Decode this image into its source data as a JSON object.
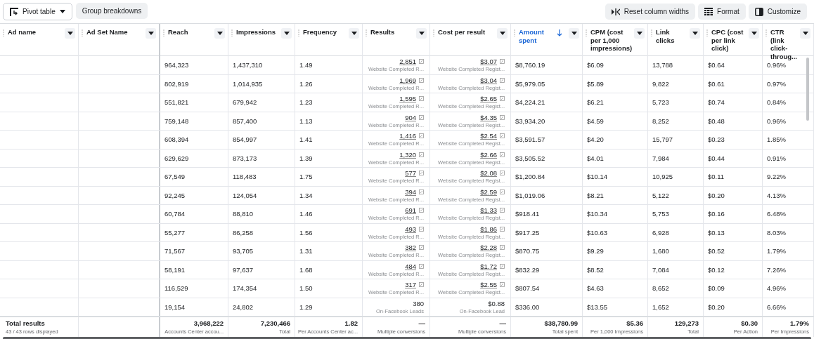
{
  "toolbar": {
    "left": [
      {
        "label": "Pivot table",
        "kind": "pivot"
      },
      {
        "label": "Group breakdowns",
        "kind": "plain"
      }
    ],
    "right": [
      {
        "label": "Reset column widths",
        "kind": "reset"
      },
      {
        "label": "Format",
        "kind": "format"
      },
      {
        "label": "Customize",
        "kind": "customize"
      }
    ]
  },
  "columns": [
    {
      "label": "Ad name",
      "sorted": false
    },
    {
      "label": "Ad Set Name",
      "sorted": false
    },
    {
      "label": "Reach",
      "sorted": false
    },
    {
      "label": "Impressions",
      "sorted": false
    },
    {
      "label": "Frequency",
      "sorted": false
    },
    {
      "label": "Results",
      "sorted": false
    },
    {
      "label": "Cost per result",
      "sorted": false
    },
    {
      "label": "Amount spent",
      "sorted": true
    },
    {
      "label": "CPM (cost per 1,000 impressions)",
      "sorted": false
    },
    {
      "label": "Link clicks",
      "sorted": false
    },
    {
      "label": "CPC (cost per link click)",
      "sorted": false
    },
    {
      "label": "CTR (link click-throug...",
      "sorted": false
    }
  ],
  "rows": [
    {
      "reach": "964,323",
      "impressions": "1,437,310",
      "frequency": "1.49",
      "results": {
        "value": "2,851",
        "note": "Website Completed R...",
        "linked": true
      },
      "cost": {
        "value": "$3.07",
        "note": "Website Completed Regist...",
        "linked": true
      },
      "amount": "$8,760.19",
      "cpm": "$6.09",
      "clicks": "13,788",
      "cpc": "$0.64",
      "ctr": "0.96%"
    },
    {
      "reach": "802,919",
      "impressions": "1,014,935",
      "frequency": "1.26",
      "results": {
        "value": "1,969",
        "note": "Website Completed R...",
        "linked": true
      },
      "cost": {
        "value": "$3.04",
        "note": "Website Completed Regist...",
        "linked": true
      },
      "amount": "$5,979.05",
      "cpm": "$5.89",
      "clicks": "9,822",
      "cpc": "$0.61",
      "ctr": "0.97%"
    },
    {
      "reach": "551,821",
      "impressions": "679,942",
      "frequency": "1.23",
      "results": {
        "value": "1,595",
        "note": "Website Completed R...",
        "linked": true
      },
      "cost": {
        "value": "$2.65",
        "note": "Website Completed Regist...",
        "linked": true
      },
      "amount": "$4,224.21",
      "cpm": "$6.21",
      "clicks": "5,723",
      "cpc": "$0.74",
      "ctr": "0.84%"
    },
    {
      "reach": "759,148",
      "impressions": "857,400",
      "frequency": "1.13",
      "results": {
        "value": "904",
        "note": "Website Completed R...",
        "linked": true
      },
      "cost": {
        "value": "$4.35",
        "note": "Website Completed Regist...",
        "linked": true
      },
      "amount": "$3,934.20",
      "cpm": "$4.59",
      "clicks": "8,252",
      "cpc": "$0.48",
      "ctr": "0.96%"
    },
    {
      "reach": "608,394",
      "impressions": "854,997",
      "frequency": "1.41",
      "results": {
        "value": "1,416",
        "note": "Website Completed R...",
        "linked": true
      },
      "cost": {
        "value": "$2.54",
        "note": "Website Completed Regist...",
        "linked": true
      },
      "amount": "$3,591.57",
      "cpm": "$4.20",
      "clicks": "15,797",
      "cpc": "$0.23",
      "ctr": "1.85%"
    },
    {
      "reach": "629,629",
      "impressions": "873,173",
      "frequency": "1.39",
      "results": {
        "value": "1,320",
        "note": "Website Completed R...",
        "linked": true
      },
      "cost": {
        "value": "$2.66",
        "note": "Website Completed Regist...",
        "linked": true
      },
      "amount": "$3,505.52",
      "cpm": "$4.01",
      "clicks": "7,984",
      "cpc": "$0.44",
      "ctr": "0.91%"
    },
    {
      "reach": "67,549",
      "impressions": "118,483",
      "frequency": "1.75",
      "results": {
        "value": "577",
        "note": "Website Completed R...",
        "linked": true
      },
      "cost": {
        "value": "$2.08",
        "note": "Website Completed Regist...",
        "linked": true
      },
      "amount": "$1,200.84",
      "cpm": "$10.14",
      "clicks": "10,925",
      "cpc": "$0.11",
      "ctr": "9.22%"
    },
    {
      "reach": "92,245",
      "impressions": "124,054",
      "frequency": "1.34",
      "results": {
        "value": "394",
        "note": "Website Completed R...",
        "linked": true
      },
      "cost": {
        "value": "$2.59",
        "note": "Website Completed Regist...",
        "linked": true
      },
      "amount": "$1,019.06",
      "cpm": "$8.21",
      "clicks": "5,122",
      "cpc": "$0.20",
      "ctr": "4.13%"
    },
    {
      "reach": "60,784",
      "impressions": "88,810",
      "frequency": "1.46",
      "results": {
        "value": "691",
        "note": "Website Completed R...",
        "linked": true
      },
      "cost": {
        "value": "$1.33",
        "note": "Website Completed Regist...",
        "linked": true
      },
      "amount": "$918.41",
      "cpm": "$10.34",
      "clicks": "5,753",
      "cpc": "$0.16",
      "ctr": "6.48%"
    },
    {
      "reach": "55,277",
      "impressions": "86,258",
      "frequency": "1.56",
      "results": {
        "value": "493",
        "note": "Website Completed R...",
        "linked": true
      },
      "cost": {
        "value": "$1.86",
        "note": "Website Completed Regist...",
        "linked": true
      },
      "amount": "$917.25",
      "cpm": "$10.63",
      "clicks": "6,928",
      "cpc": "$0.13",
      "ctr": "8.03%"
    },
    {
      "reach": "71,567",
      "impressions": "93,705",
      "frequency": "1.31",
      "results": {
        "value": "382",
        "note": "Website Completed R...",
        "linked": true
      },
      "cost": {
        "value": "$2.28",
        "note": "Website Completed Regist...",
        "linked": true
      },
      "amount": "$870.75",
      "cpm": "$9.29",
      "clicks": "1,680",
      "cpc": "$0.52",
      "ctr": "1.79%"
    },
    {
      "reach": "58,191",
      "impressions": "97,637",
      "frequency": "1.68",
      "results": {
        "value": "484",
        "note": "Website Completed R...",
        "linked": true
      },
      "cost": {
        "value": "$1.72",
        "note": "Website Completed Regist...",
        "linked": true
      },
      "amount": "$832.29",
      "cpm": "$8.52",
      "clicks": "7,084",
      "cpc": "$0.12",
      "ctr": "7.26%"
    },
    {
      "reach": "116,529",
      "impressions": "174,354",
      "frequency": "1.50",
      "results": {
        "value": "317",
        "note": "Website Completed R...",
        "linked": true
      },
      "cost": {
        "value": "$2.55",
        "note": "Website Completed Regist...",
        "linked": true
      },
      "amount": "$807.54",
      "cpm": "$4.63",
      "clicks": "8,652",
      "cpc": "$0.09",
      "ctr": "4.96%"
    },
    {
      "reach": "19,154",
      "impressions": "24,802",
      "frequency": "1.29",
      "results": {
        "value": "380",
        "note": "On-Facebook Leads",
        "linked": false
      },
      "cost": {
        "value": "$0.88",
        "note": "On-Facebook Lead",
        "linked": false
      },
      "amount": "$336.00",
      "cpm": "$13.55",
      "clicks": "1,652",
      "cpc": "$0.20",
      "ctr": "6.66%"
    }
  ],
  "totals": {
    "title": "Total results",
    "subtitle": "43 / 43 rows displayed",
    "columns": [
      {
        "value": "3,968,222",
        "label": "Accounts Center accou..."
      },
      {
        "value": "7,230,466",
        "label": "Total"
      },
      {
        "value": "1.82",
        "label": "Per Accounts Center ac..."
      },
      {
        "value": "—",
        "label": "Multiple conversions"
      },
      {
        "value": "—",
        "label": "Multiple conversions"
      },
      {
        "value": "$38,780.99",
        "label": "Total spent"
      },
      {
        "value": "$5.36",
        "label": "Per 1,000 Impressions"
      },
      {
        "value": "129,273",
        "label": "Total"
      },
      {
        "value": "$0.30",
        "label": "Per Action"
      },
      {
        "value": "1.79%",
        "label": "Per Impressions"
      }
    ]
  }
}
